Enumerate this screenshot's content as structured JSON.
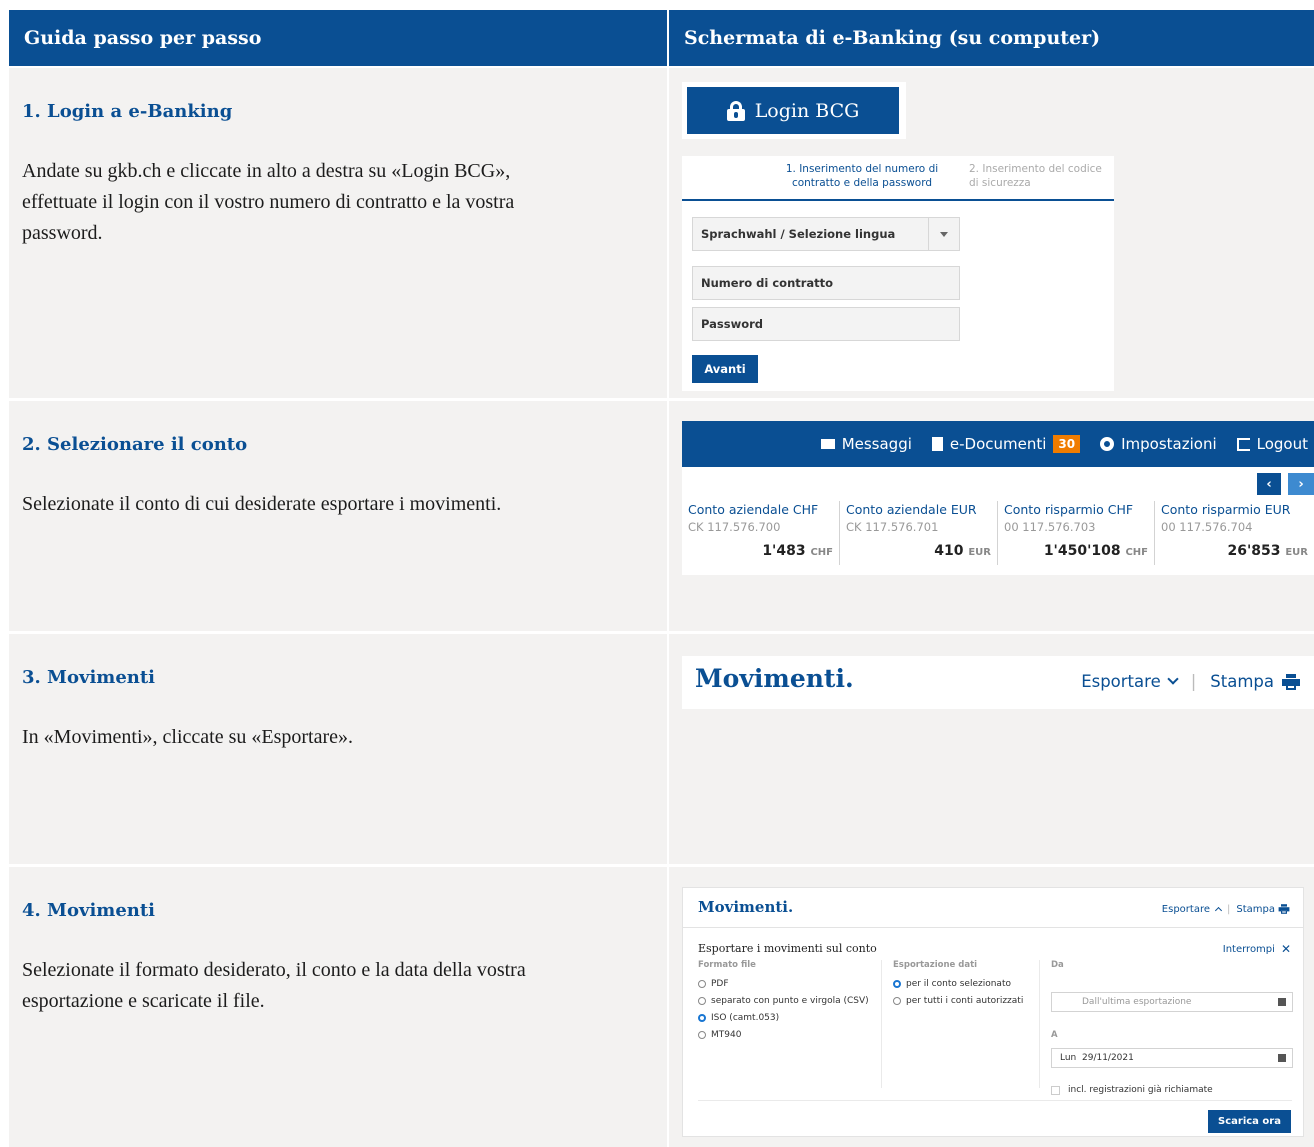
{
  "headers": {
    "left": "Guida passo per passo",
    "right": "Schermata di e-Banking (su computer)"
  },
  "steps": [
    {
      "title": "1. Login a e-Banking",
      "text": "Andate su gkb.ch e cliccate in alto a destra su «Login BCG», effettuate il login con il vostro numero di contratto e la vostra password."
    },
    {
      "title": "2. Selezionare il conto",
      "text": "Selezionate il conto di cui desiderate esportare i movimenti."
    },
    {
      "title": "3. Movimenti",
      "text": "In «Movimenti», cliccate su «Esportare»."
    },
    {
      "title": "4. Movimenti",
      "text": "Selezionate il formato desiderato, il conto e la data della vostra esportazione e scaricate il file."
    }
  ],
  "login": {
    "button": "Login BCG",
    "step1": "1. Inserimento del numero di contratto e della password",
    "step2": "2. Inserimento del codice di sicurezza",
    "language": "Sprachwahl / Selezione lingua",
    "contract_placeholder": "Numero di contratto",
    "password_placeholder": "Password",
    "next": "Avanti"
  },
  "banking": {
    "messages": "Messaggi",
    "documents": "e-Documenti",
    "documents_count": "30",
    "settings": "Impostazioni",
    "logout": "Logout",
    "prev": "‹",
    "next": "›",
    "accounts": [
      {
        "name": "Conto aziendale CHF",
        "number": "CK 117.576.700",
        "balance": "1'483",
        "currency": "CHF"
      },
      {
        "name": "Conto aziendale EUR",
        "number": "CK 117.576.701",
        "balance": "410",
        "currency": "EUR"
      },
      {
        "name": "Conto risparmio CHF",
        "number": "00 117.576.703",
        "balance": "1'450'108",
        "currency": "CHF"
      },
      {
        "name": "Conto risparmio EUR",
        "number": "00 117.576.704",
        "balance": "26'853",
        "currency": "EUR"
      }
    ]
  },
  "movements": {
    "title": "Movimenti.",
    "export": "Esportare",
    "print": "Stampa"
  },
  "export_panel": {
    "title": "Movimenti.",
    "export": "Esportare",
    "print": "Stampa",
    "subtitle": "Esportare i movimenti sul conto",
    "cancel": "Interrompi",
    "file_format_label": "Formato file",
    "formats": [
      "PDF",
      "separato con punto e virgola (CSV)",
      "ISO (camt.053)",
      "MT940"
    ],
    "export_data_label": "Esportazione dati",
    "scopes": [
      "per il conto selezionato",
      "per tutti i conti autorizzati"
    ],
    "from_label": "Da",
    "from_placeholder": "Dall'ultima esportazione",
    "to_label": "A",
    "to_value": "Lun  29/11/2021",
    "include_label": "incl. registrazioni già richiamate",
    "download": "Scarica ora"
  }
}
